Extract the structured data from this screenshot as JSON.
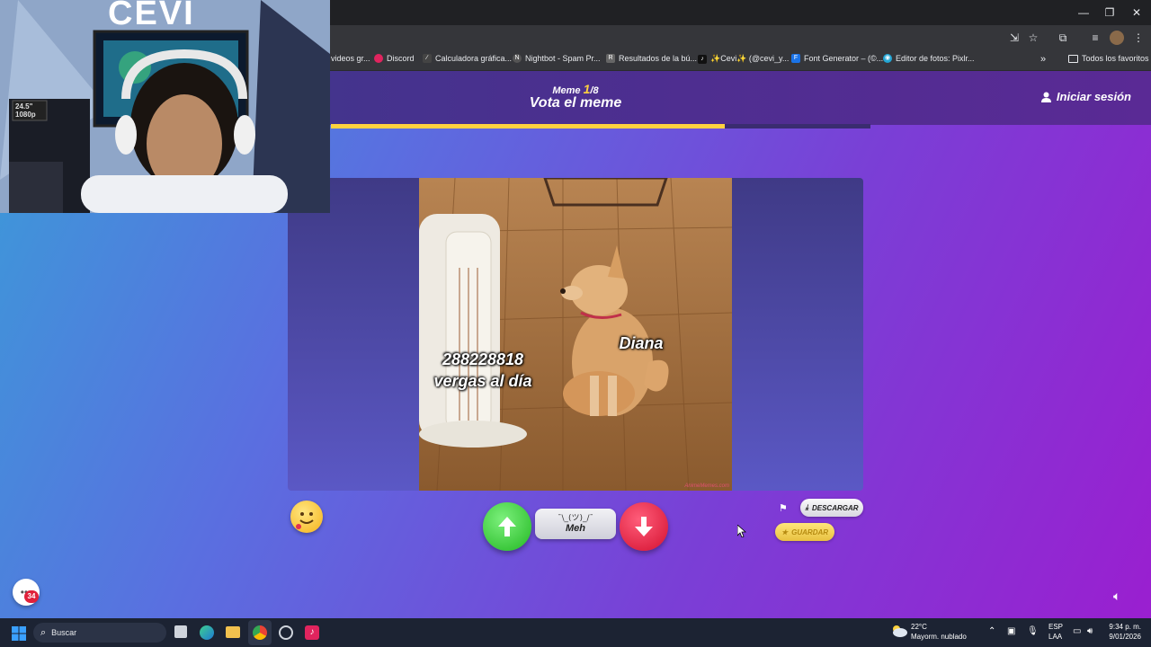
{
  "window": {
    "minimize": "—",
    "restore": "❐",
    "close": "✕"
  },
  "bookmarks": [
    {
      "label": "videos gr...",
      "icon": "",
      "color": "#888888"
    },
    {
      "label": "Discord",
      "icon": "D",
      "color": "#5865f2"
    },
    {
      "label": "Calculadora gráfica...",
      "icon": "∕",
      "color": "#777777"
    },
    {
      "label": "Nightbot - Spam Pr...",
      "icon": "N",
      "color": "#555555"
    },
    {
      "label": "Resultados de la bú...",
      "icon": "R",
      "color": "#666666"
    },
    {
      "label": "✨Cevi✨ (@cevi_y...",
      "icon": "♪",
      "color": "#111111"
    },
    {
      "label": "Font Generator – (©...",
      "icon": "F",
      "color": "#1a73e8"
    },
    {
      "label": "Editor de fotos: Pixlr...",
      "icon": "◉",
      "color": "#23a6d5"
    }
  ],
  "bookmarks_more": "»",
  "all_favorites": "Todos los favoritos",
  "header": {
    "meme_label": "Meme",
    "meme_current": "1",
    "meme_total": "/8",
    "title": "Vota el meme",
    "login": "Iniciar sesión"
  },
  "progress": {
    "fraction": 0.73,
    "color": "#ffd23f"
  },
  "meme": {
    "text_left_1": "288228818",
    "text_left_2": "vergas al día",
    "text_right": "Diana",
    "watermark": "AnimeMemes.com"
  },
  "actions": {
    "meh_face": "¯\\_(ツ)_/¯",
    "meh": "Meh",
    "download": "DESCARGAR",
    "save": "GUARDAR"
  },
  "chat_badge": "34",
  "taskbar": {
    "search": "Buscar",
    "weather_temp": "22°C",
    "weather_desc": "Mayorm. nublado",
    "lang_1": "ESP",
    "lang_2": "LAA",
    "time": "9:34 p. m.",
    "date": "9/01/2026"
  },
  "webcam_sign": "CEVI",
  "monitor_label_1": "24.5\"",
  "monitor_label_2": "1080p"
}
